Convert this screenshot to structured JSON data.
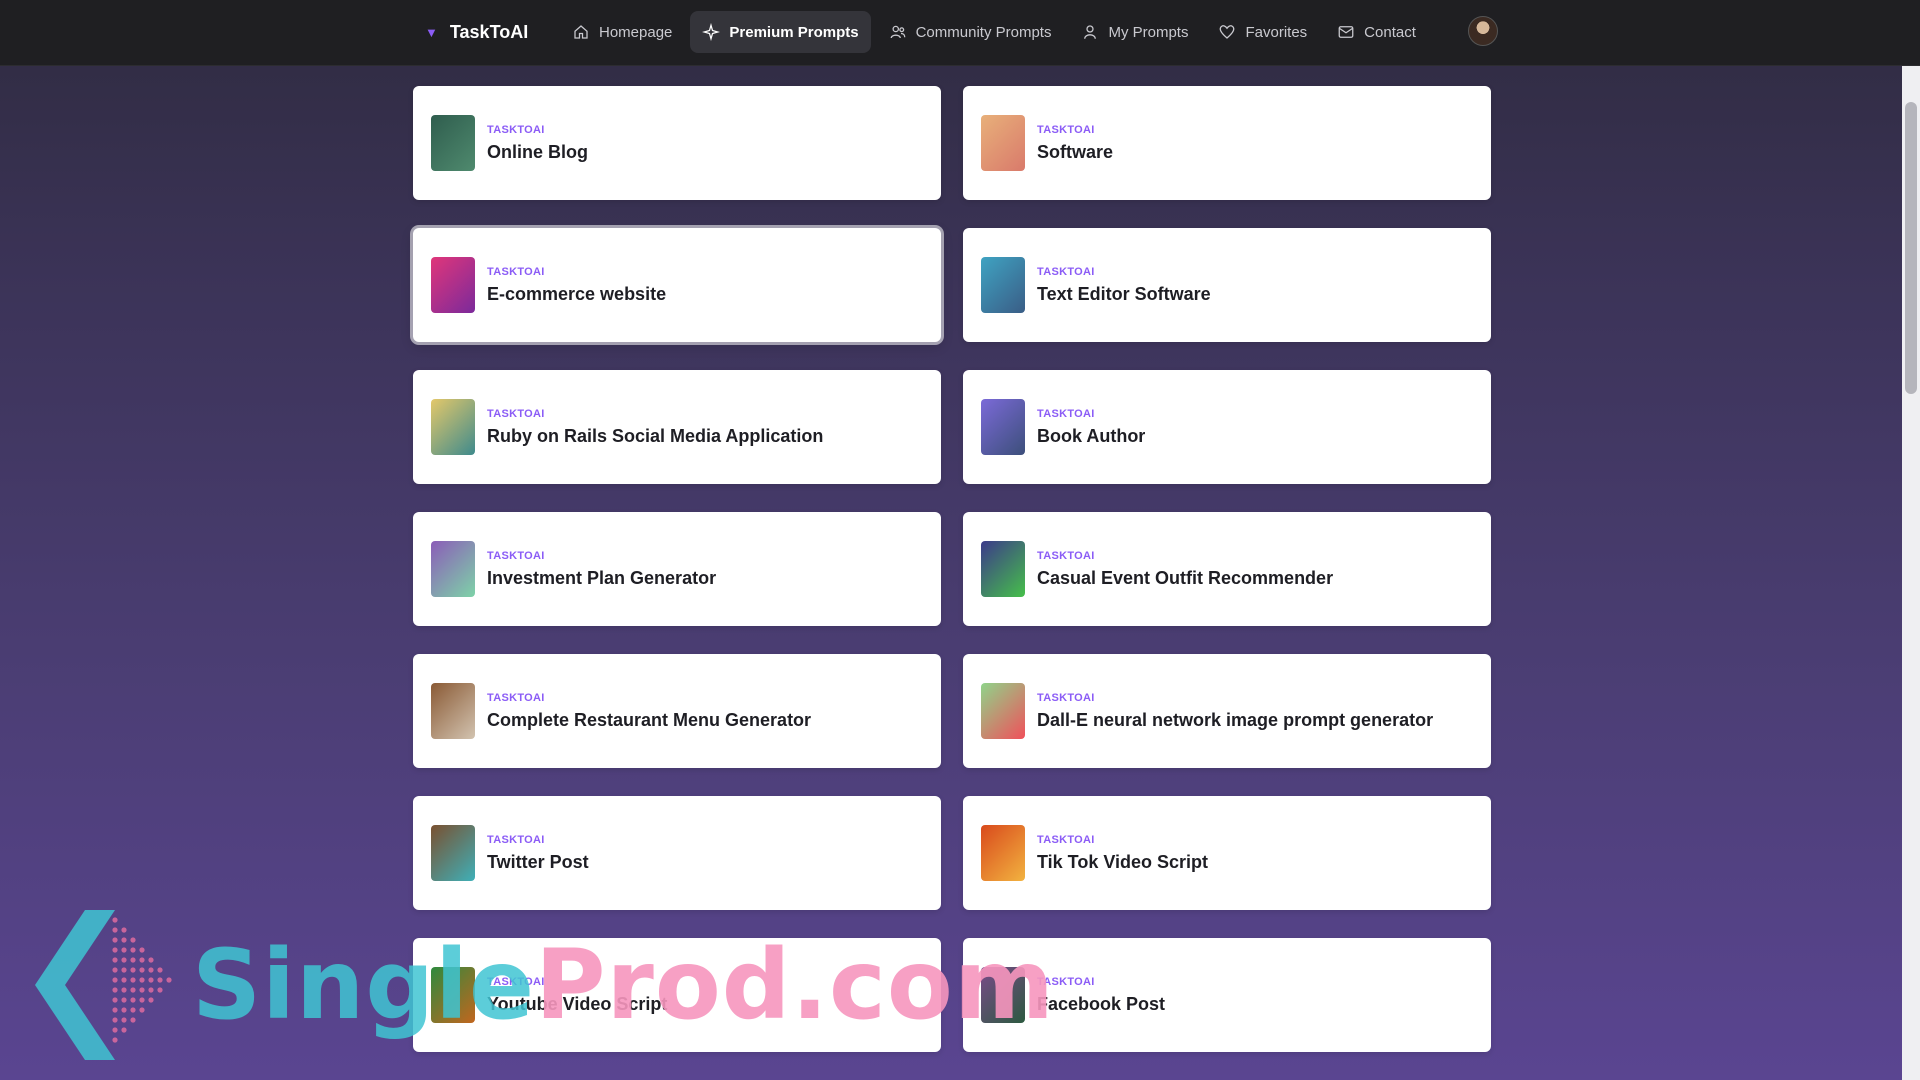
{
  "app": {
    "name": "TaskToAI"
  },
  "nav": [
    {
      "label": "Homepage",
      "icon": "home-icon"
    },
    {
      "label": "Premium Prompts",
      "icon": "sparkle-icon",
      "active": true
    },
    {
      "label": "Community Prompts",
      "icon": "users-icon"
    },
    {
      "label": "My Prompts",
      "icon": "user-icon"
    },
    {
      "label": "Favorites",
      "icon": "heart-icon"
    },
    {
      "label": "Contact",
      "icon": "mail-icon"
    }
  ],
  "cards": [
    {
      "tag": "TASKTOAI",
      "title": "Online Blog",
      "colors": [
        "#2f5d4e",
        "#4f8a6e"
      ]
    },
    {
      "tag": "TASKTOAI",
      "title": "Software",
      "colors": [
        "#e8b07a",
        "#d97a6b"
      ]
    },
    {
      "tag": "TASKTOAI",
      "title": "E-commerce website",
      "colors": [
        "#e0367a",
        "#7b2a9b"
      ]
    },
    {
      "tag": "TASKTOAI",
      "title": "Text Editor Software",
      "colors": [
        "#3fa3c2",
        "#3a5d86"
      ]
    },
    {
      "tag": "TASKTOAI",
      "title": "Ruby on Rails Social Media Application",
      "colors": [
        "#e4c86a",
        "#3e8a8c"
      ]
    },
    {
      "tag": "TASKTOAI",
      "title": "Book Author",
      "colors": [
        "#7b6ad8",
        "#3c4f7a"
      ]
    },
    {
      "tag": "TASKTOAI",
      "title": "Investment Plan Generator",
      "colors": [
        "#8b5cb8",
        "#7ed3a8"
      ]
    },
    {
      "tag": "TASKTOAI",
      "title": "Casual Event Outfit Recommender",
      "colors": [
        "#3c3a8a",
        "#46c04a"
      ]
    },
    {
      "tag": "TASKTOAI",
      "title": "Complete Restaurant Menu Generator",
      "colors": [
        "#8a5a35",
        "#d2c3b0"
      ]
    },
    {
      "tag": "TASKTOAI",
      "title": "Dall-E neural network image prompt generator",
      "colors": [
        "#8fd48a",
        "#f0505a"
      ]
    },
    {
      "tag": "TASKTOAI",
      "title": "Twitter Post",
      "colors": [
        "#7a5030",
        "#3fb0b8"
      ]
    },
    {
      "tag": "TASKTOAI",
      "title": "Tik Tok Video Script",
      "colors": [
        "#d94a1c",
        "#f2b340"
      ]
    },
    {
      "tag": "TASKTOAI",
      "title": "Youtube Video Script",
      "colors": [
        "#2e8a3e",
        "#c2661e"
      ]
    },
    {
      "tag": "TASKTOAI",
      "title": "Facebook Post",
      "colors": [
        "#7a4a8a",
        "#2c5a40"
      ]
    }
  ],
  "watermark": {
    "text_a": "Single",
    "text_b": "Prod.com"
  },
  "colors": {
    "accent": "#8b5cf6",
    "topbar": "#1f1f22"
  }
}
